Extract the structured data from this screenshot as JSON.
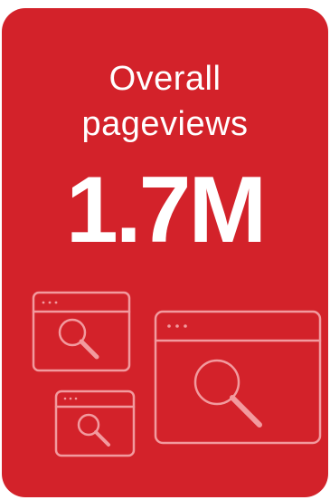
{
  "card": {
    "title_line1": "Overall",
    "title_line2": "pageviews",
    "metric_value": "1.7M",
    "background_color": "#d3222a",
    "icon_stroke_color": "#f29a9e"
  },
  "icons": [
    "browser-search-icon-small-top",
    "browser-search-icon-large",
    "browser-search-icon-small-bottom"
  ]
}
